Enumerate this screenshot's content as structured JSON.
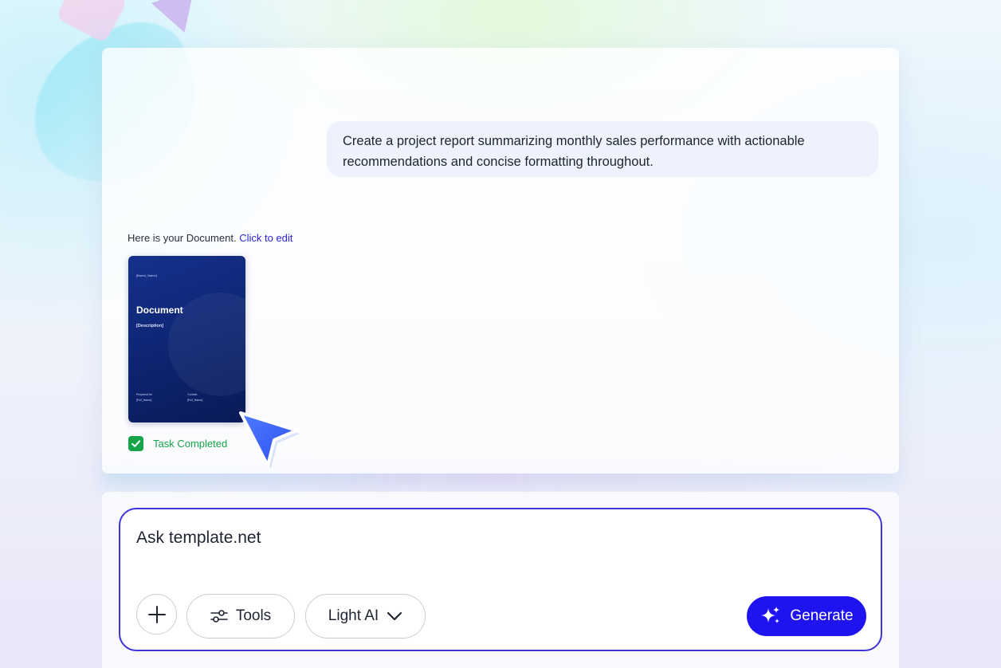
{
  "chat": {
    "user_message": "Create a project report summarizing monthly sales performance with actionable recommendations and concise formatting throughout.",
    "response_intro": "Here is your Document.",
    "edit_link": "Click to edit",
    "document_preview": {
      "brand": "[Brand_Name]",
      "title": "Document",
      "description": "[Description]",
      "prepared_for_label": "Prepared for",
      "prepared_for_value": "[Full_Name]",
      "contact_label": "Contact",
      "contact_value": "[Full_Name]"
    },
    "task_status": "Task Completed"
  },
  "composer": {
    "placeholder": "Ask template.net",
    "tools_label": "Tools",
    "model_label": "Light AI",
    "generate_label": "Generate"
  },
  "colors": {
    "accent": "#1f14f0",
    "border_accent": "#3f35d8",
    "success": "#16a34a",
    "link": "#2c26e0",
    "document_bg": "#0d2470"
  },
  "icons": [
    "plus-icon",
    "sliders-icon",
    "chevron-down-icon",
    "sparkle-icon",
    "check-icon",
    "cursor-icon"
  ]
}
